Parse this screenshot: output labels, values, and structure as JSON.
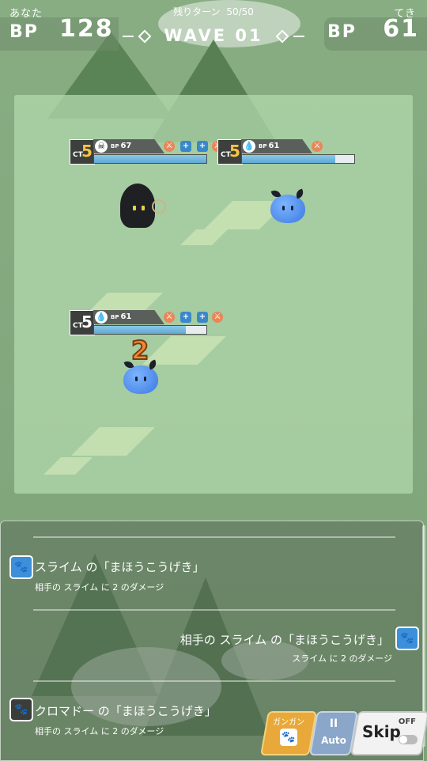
{
  "hud": {
    "player_label": "あなた",
    "bp_label": "BP",
    "player_bp": "128",
    "enemy_label": "てき",
    "enemy_bp": "61",
    "turns_label": "残りターン",
    "turns_value": "50/50",
    "wave_label": "WAVE 01"
  },
  "units": {
    "ally_ghost": {
      "ct_label": "CT",
      "ct": "5",
      "element_icon": "skull-icon",
      "bp_prefix": "BP",
      "bp": "67",
      "hp_fraction": 1.0
    },
    "enemy_slime": {
      "ct_label": "CT",
      "ct": "5",
      "element_icon": "water-drop-icon",
      "bp_prefix": "BP",
      "bp": "61",
      "hp_fraction": 0.83
    },
    "ally_slime": {
      "ct_label": "CT",
      "ct": "5",
      "element_icon": "water-drop-icon",
      "bp_prefix": "BP",
      "bp": "61",
      "hp_fraction": 0.82
    }
  },
  "damage_popup": "2",
  "log": [
    {
      "title": "スライム の「まほうこうげき」",
      "sub": "相手の スライム に 2 のダメージ",
      "side": "ally"
    },
    {
      "title": "相手の スライム の「まほうこうげき」",
      "sub": "スライム に 2 のダメージ",
      "side": "enemy"
    },
    {
      "title": "クロマドー の「まほうこうげき」",
      "sub": "相手の スライム に 2 のダメージ",
      "side": "ally"
    }
  ],
  "buttons": {
    "gangan_label": "ガンガン",
    "auto_icon": "II",
    "auto_label": "Auto",
    "skip_label": "Skip",
    "skip_state": "OFF"
  },
  "colors": {
    "hp_fill": "#5fa8d4",
    "accent_gold": "#f6c445",
    "damage": "#f08a32"
  }
}
